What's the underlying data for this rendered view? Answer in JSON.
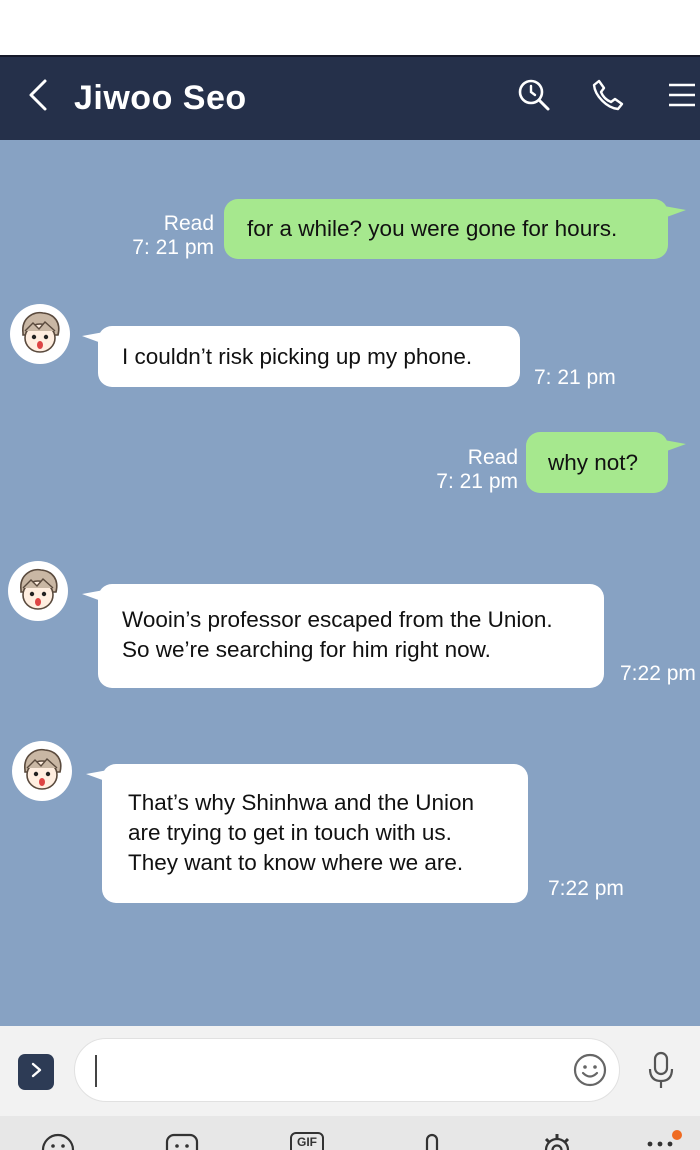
{
  "header": {
    "title": "Jiwoo Seo",
    "icons": [
      "back-arrow-icon",
      "search-icon",
      "phone-icon",
      "menu-icon"
    ]
  },
  "messages": [
    {
      "side": "sent",
      "lines": [
        "for a while? you were gone for hours."
      ],
      "read_label": "Read",
      "time": "7: 21 pm"
    },
    {
      "side": "received",
      "lines": [
        "I couldn’t risk picking up my phone."
      ],
      "time": "7: 21 pm"
    },
    {
      "side": "sent",
      "lines": [
        "why not?"
      ],
      "read_label": "Read",
      "time": "7: 21 pm"
    },
    {
      "side": "received",
      "lines": [
        "Wooin’s professor escaped from the Union.",
        "So we’re searching for him right now."
      ],
      "time": "7:22 pm"
    },
    {
      "side": "received",
      "lines": [
        "That’s why Shinhwa and the Union",
        "are trying to get in touch with us.",
        "They want to know where we are."
      ],
      "time": "7:22 pm"
    }
  ],
  "input": {
    "value": "",
    "icons": [
      "expand-icon",
      "emoji-icon",
      "microphone-icon"
    ]
  },
  "bottom_bar": {
    "icons": [
      "emoticon-icon",
      "sticker-icon",
      "gif-icon",
      "clip-icon",
      "settings-icon",
      "more-icon"
    ],
    "gif_label": "GIF"
  },
  "colors": {
    "header_bg": "#25304a",
    "chat_bg": "#87a2c3",
    "sent_bubble": "#a6e88e",
    "received_bubble": "#ffffff",
    "notification_dot": "#ef6b21"
  }
}
